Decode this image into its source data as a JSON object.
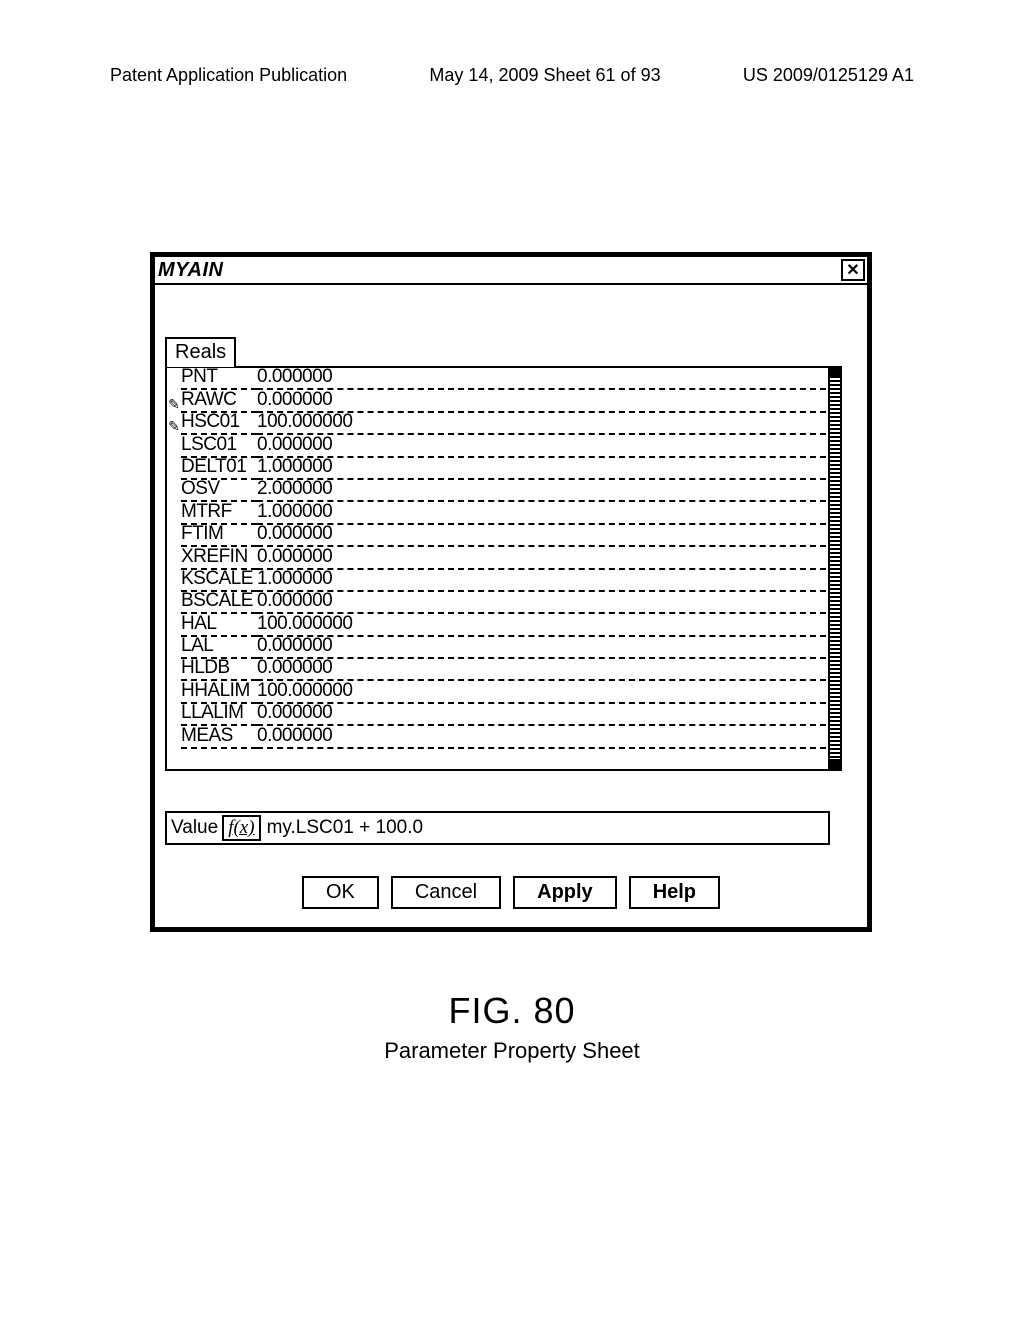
{
  "header": {
    "left": "Patent Application Publication",
    "mid": "May 14, 2009  Sheet 61 of 93",
    "right": "US 2009/0125129 A1"
  },
  "window": {
    "title": "MYAIN",
    "close": "✕",
    "tab": "Reals"
  },
  "rows": [
    {
      "pencil": "",
      "name": "PNT",
      "val": "0.000000"
    },
    {
      "pencil": "✎",
      "name": "RAWC",
      "val": "0.000000"
    },
    {
      "pencil": "✎",
      "name": "HSC01",
      "val": "100.000000"
    },
    {
      "pencil": "",
      "name": "LSC01",
      "val": "0.000000"
    },
    {
      "pencil": "",
      "name": "DELT01",
      "val": "1.000000"
    },
    {
      "pencil": "",
      "name": "OSV",
      "val": "2.000000"
    },
    {
      "pencil": "",
      "name": "MTRF",
      "val": "1.000000"
    },
    {
      "pencil": "",
      "name": "FTIM",
      "val": "0.000000"
    },
    {
      "pencil": "",
      "name": "XREFIN",
      "val": "0.000000"
    },
    {
      "pencil": "",
      "name": "KSCALE",
      "val": "1.000000"
    },
    {
      "pencil": "",
      "name": "BSCALE",
      "val": "0.000000"
    },
    {
      "pencil": "",
      "name": "HAL",
      "val": "100.000000"
    },
    {
      "pencil": "",
      "name": "LAL",
      "val": "0.000000"
    },
    {
      "pencil": "",
      "name": "HLDB",
      "val": "0.000000"
    },
    {
      "pencil": "",
      "name": "HHALIM",
      "val": "100.000000"
    },
    {
      "pencil": "",
      "name": "LLALIM",
      "val": "0.000000"
    },
    {
      "pencil": "",
      "name": "MEAS",
      "val": "0.000000"
    }
  ],
  "value": {
    "label": "Value",
    "fx": "f(x)",
    "expr": "my.LSC01 + 100.0"
  },
  "buttons": {
    "ok": "OK",
    "cancel": "Cancel",
    "apply": "Apply",
    "help": "Help"
  },
  "figure": {
    "num": "FIG. 80",
    "caption": "Parameter Property Sheet"
  }
}
